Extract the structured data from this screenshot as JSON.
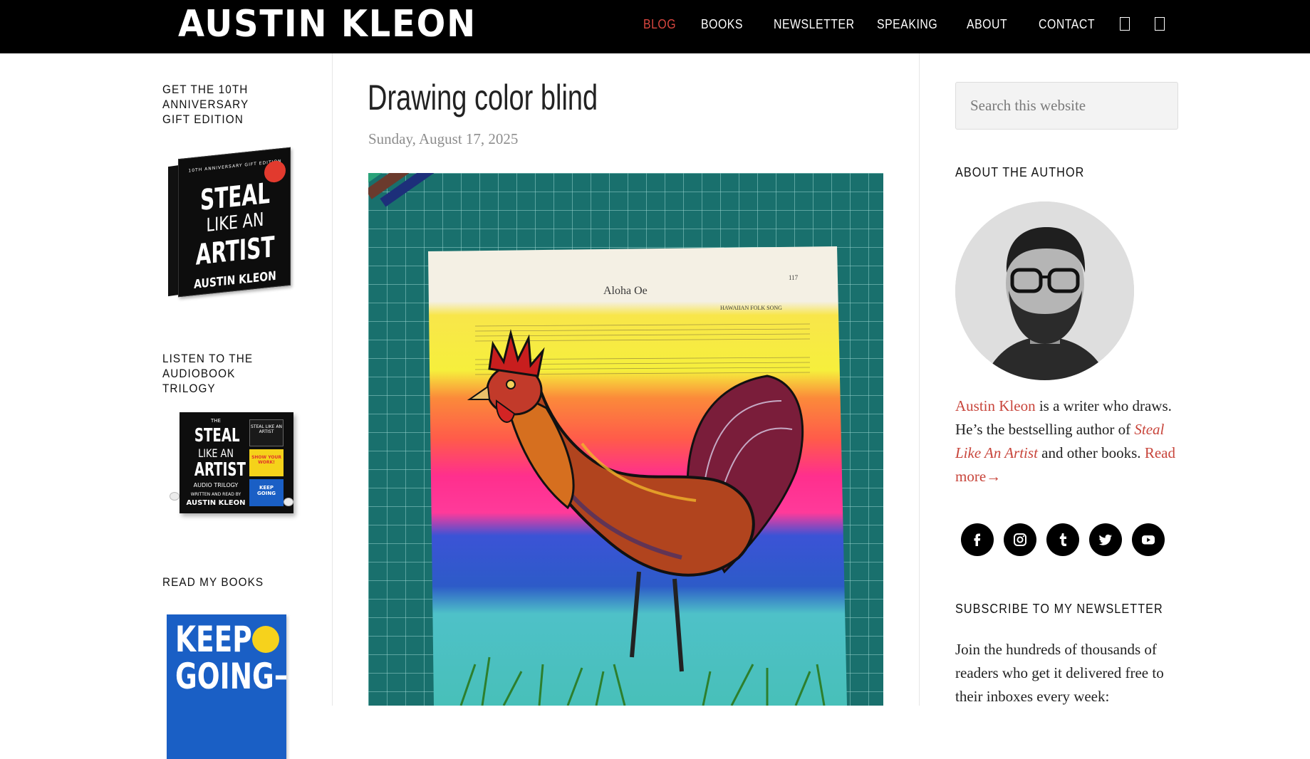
{
  "header": {
    "logo": "AUSTIN KLEON",
    "nav": [
      {
        "label": "BLOG",
        "active": true
      },
      {
        "label": "BOOKS",
        "active": false
      },
      {
        "label": "NEWSLETTER",
        "active": false
      },
      {
        "label": "SPEAKING",
        "active": false
      },
      {
        "label": "ABOUT",
        "active": false
      },
      {
        "label": "CONTACT",
        "active": false
      }
    ],
    "icons": [
      "search-icon",
      "menu-icon"
    ],
    "accent": "#d8463f"
  },
  "left_sidebar": {
    "widgets": [
      {
        "title": "GET THE 10TH ANNIVERSARY GIFT EDITION",
        "book": {
          "edition_line": "10TH ANNIVERSARY GIFT EDITION",
          "title_lines": [
            "STEAL",
            "LIKE AN",
            "ARTIST"
          ],
          "author": "AUSTIN KLEON"
        }
      },
      {
        "title": "LISTEN TO THE AUDIOBOOK TRILOGY",
        "book": {
          "title_lines": [
            "THE",
            "STEAL",
            "LIKE AN",
            "ARTIST",
            "AUDIO TRILOGY"
          ],
          "credit_line": "WRITTEN AND READ BY",
          "author": "AUSTIN KLEON",
          "mini_books": [
            "STEAL LIKE AN ARTIST",
            "SHOW YOUR WORK!",
            "KEEP GOING"
          ]
        }
      },
      {
        "title": "READ MY BOOKS",
        "book": {
          "title_lines": [
            "KEEP",
            "GOING→"
          ]
        }
      }
    ]
  },
  "post": {
    "title": "Drawing color blind",
    "date": "Sunday, August 17, 2025",
    "image": {
      "subject": "rooster-drawing",
      "page_heading": "Aloha Oe",
      "page_subheading": "HAWAIIAN FOLK SONG",
      "page_number": "117"
    }
  },
  "right_sidebar": {
    "search": {
      "placeholder": "Search this website",
      "value": ""
    },
    "about": {
      "title": "ABOUT THE AUTHOR",
      "name_link": "Austin Kleon",
      "text_1": " is a writer who draws. He’s the bestselling author of ",
      "book_link": "Steal Like An Artist",
      "text_2": " and other books. ",
      "read_more": "Read more→"
    },
    "social": [
      "facebook-icon",
      "instagram-icon",
      "tumblr-icon",
      "twitter-icon",
      "youtube-icon"
    ],
    "newsletter": {
      "title": "SUBSCRIBE TO MY NEWSLETTER",
      "text": "Join the hundreds of thousands of readers who get it delivered free to their inboxes every week:"
    },
    "link_color": "#c8453b"
  }
}
